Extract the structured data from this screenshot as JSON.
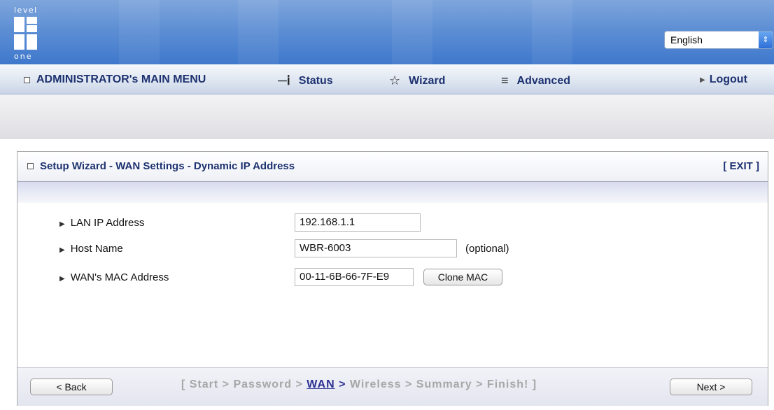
{
  "header": {
    "logo_text_top": "level",
    "logo_text_bottom": "one",
    "language": {
      "selected": "English"
    }
  },
  "menu": {
    "main_label": "ADMINISTRATOR's MAIN MENU",
    "status": "Status",
    "wizard": "Wizard",
    "advanced": "Advanced",
    "logout": "Logout"
  },
  "panel": {
    "title": "Setup Wizard - WAN Settings - Dynamic IP Address",
    "exit": "[ EXIT ]",
    "fields": {
      "lan_ip": {
        "label": "LAN IP Address",
        "value": "192.168.1.1"
      },
      "host_name": {
        "label": "Host Name",
        "value": "WBR-6003",
        "note": "(optional)"
      },
      "wan_mac": {
        "label": "WAN's MAC Address",
        "value": "00-11-6B-66-7F-E9",
        "clone_button": "Clone MAC"
      }
    }
  },
  "footer": {
    "back": "< Back",
    "next": "Next >",
    "steps_open": "[ ",
    "steps": [
      "Start",
      "Password",
      "WAN",
      "Wireless",
      "Summary",
      "Finish!"
    ],
    "current_step": "WAN",
    "steps_close": " ]",
    "separator": " > "
  }
}
